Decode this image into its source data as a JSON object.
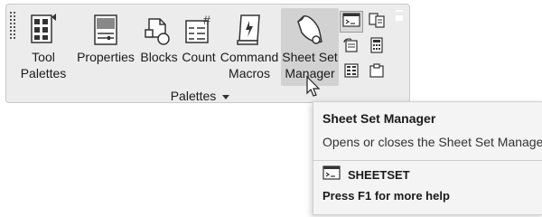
{
  "ribbon": {
    "panel_title": "Palettes",
    "buttons": [
      {
        "id": "tool-palettes",
        "label": "Tool\nPalettes",
        "icon": "tool-palettes-icon"
      },
      {
        "id": "properties",
        "label": "Properties",
        "icon": "properties-icon"
      },
      {
        "id": "blocks",
        "label": "Blocks",
        "icon": "blocks-icon"
      },
      {
        "id": "count",
        "label": "Count",
        "icon": "count-icon"
      },
      {
        "id": "command-macros",
        "label": "Command\nMacros",
        "icon": "command-macros-icon"
      },
      {
        "id": "sheet-set-manager",
        "label": "Sheet Set\nManager",
        "icon": "sheet-set-manager-icon",
        "active": true
      }
    ],
    "small_buttons": [
      {
        "id": "command-line",
        "icon": "command-line-icon",
        "active": true
      },
      {
        "id": "design-center",
        "icon": "design-center-icon"
      },
      {
        "id": "markup-set-manager",
        "icon": "markup-set-manager-icon"
      },
      {
        "id": "quickcalc",
        "icon": "calculator-icon"
      },
      {
        "id": "layer-properties",
        "icon": "grid-palette-icon"
      },
      {
        "id": "clipboard",
        "icon": "clipboard-icon"
      }
    ]
  },
  "tooltip": {
    "title": "Sheet Set Manager",
    "description": "Opens or closes the Sheet Set Manager",
    "command": "SHEETSET",
    "help": "Press F1 for more help"
  }
}
